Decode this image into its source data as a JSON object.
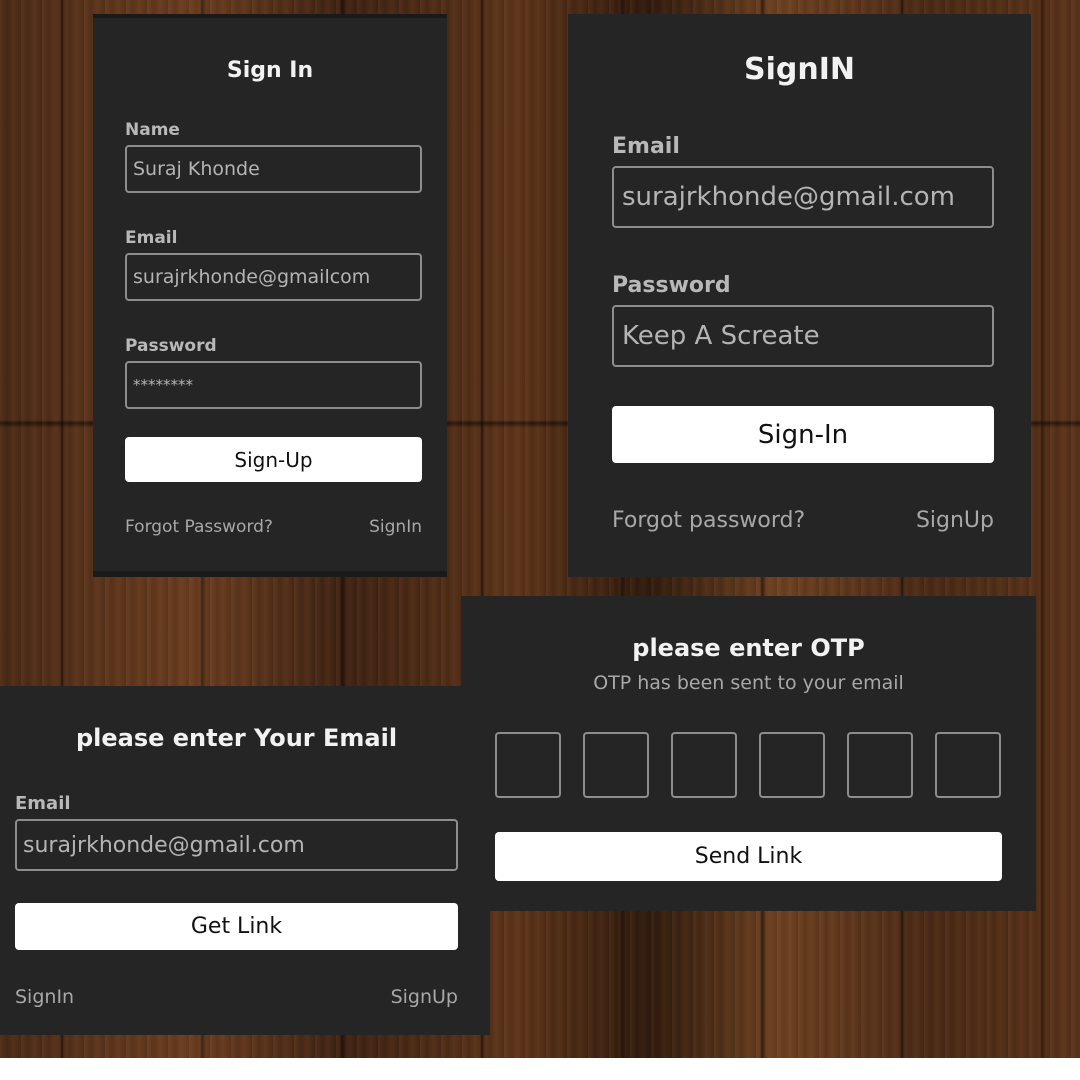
{
  "signup_card": {
    "title": "Sign In",
    "name_label": "Name",
    "name_value": "Suraj Khonde",
    "email_label": "Email",
    "email_value": "surajrkhonde@gmailcom",
    "password_label": "Password",
    "password_value": "********",
    "submit_label": "Sign-Up",
    "forgot_label": "Forgot Password?",
    "alt_link_label": "SignIn"
  },
  "signin_card": {
    "title": "SignIN",
    "email_label": "Email",
    "email_value": "surajrkhonde@gmail.com",
    "password_label": "Password",
    "password_value": "Keep A Screate",
    "submit_label": "Sign-In",
    "forgot_label": "Forgot password?",
    "alt_link_label": "SignUp"
  },
  "email_card": {
    "title": "please enter Your Email",
    "email_label": "Email",
    "email_value": "surajrkhonde@gmail.com",
    "submit_label": "Get Link",
    "signin_link_label": "SignIn",
    "signup_link_label": "SignUp"
  },
  "otp_card": {
    "title": "please enter OTP",
    "subtitle": "OTP has been sent to your email",
    "otp_digits": [
      "",
      "",
      "",
      "",
      "",
      ""
    ],
    "submit_label": "Send Link"
  },
  "colors": {
    "card_background": "#252525",
    "field_border": "#8d8d8d",
    "button_background": "#ffffff",
    "muted_text": "#a8a8a8"
  }
}
